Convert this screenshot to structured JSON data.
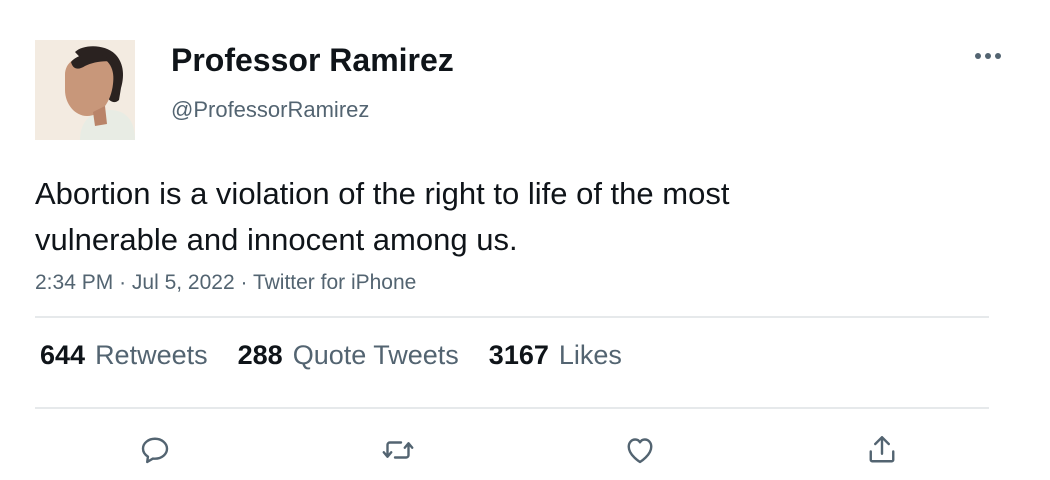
{
  "tweet": {
    "display_name": "Professor Ramirez",
    "handle": "@ProfessorRamirez",
    "text": "Abortion is a violation of the right to life of the most vulnerable and innocent among us.",
    "time": "2:34 PM",
    "date": "Jul 5, 2022",
    "source": "Twitter for iPhone",
    "separator": "·"
  },
  "stats": {
    "retweets": {
      "count": "644",
      "label": "Retweets"
    },
    "quotes": {
      "count": "288",
      "label": "Quote Tweets"
    },
    "likes": {
      "count": "3167",
      "label": "Likes"
    }
  },
  "icons": {
    "more": "more-horizontal-icon",
    "reply": "reply-icon",
    "retweet": "retweet-icon",
    "like": "heart-icon",
    "share": "share-icon"
  },
  "colors": {
    "text": "#0f1419",
    "secondary": "#536471",
    "divider": "#e6e9eb"
  }
}
